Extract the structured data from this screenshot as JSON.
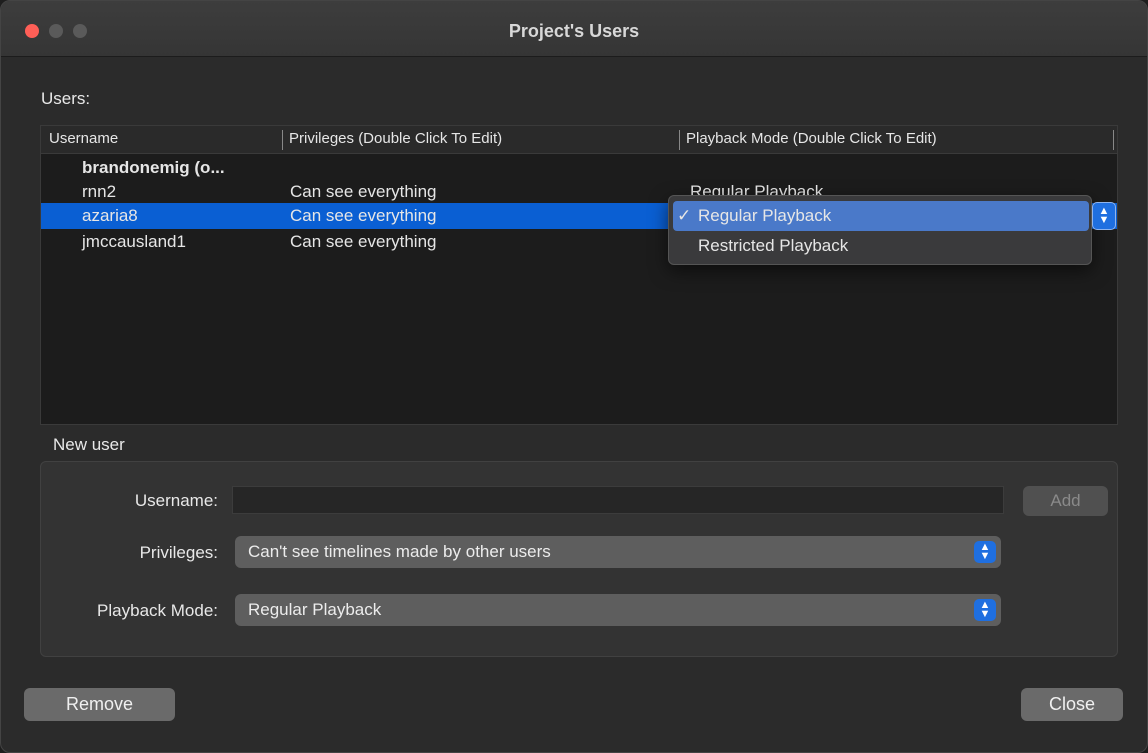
{
  "window": {
    "title": "Project's Users"
  },
  "users_section": {
    "label": "Users:"
  },
  "table": {
    "columns": [
      "Username",
      "Privileges (Double Click To Edit)",
      "Playback Mode (Double Click To Edit)"
    ],
    "rows": [
      {
        "username": "brandonemig (o...",
        "privileges": "",
        "playback": "",
        "owner": true
      },
      {
        "username": "rnn2",
        "privileges": "Can see everything",
        "playback": "Regular Playback"
      },
      {
        "username": "azaria8",
        "privileges": "Can see everything",
        "playback": "Regular Playback",
        "selected": true
      },
      {
        "username": "jmccausland1",
        "privileges": "Can see everything",
        "playback": ""
      }
    ]
  },
  "playback_popup": {
    "options": [
      {
        "label": "Regular Playback",
        "checked": true,
        "check_glyph": "✓"
      },
      {
        "label": "Restricted Playback",
        "checked": false,
        "check_glyph": ""
      }
    ],
    "stepper_icon": "up-down-chevron-icon"
  },
  "new_user": {
    "section_label": "New user",
    "username_label": "Username:",
    "username_value": "",
    "add_label": "Add",
    "privileges_label": "Privileges:",
    "privileges_value": "Can't see timelines made by other users",
    "playback_label": "Playback Mode:",
    "playback_value": "Regular Playback"
  },
  "footer": {
    "remove_label": "Remove",
    "close_label": "Close"
  },
  "colors": {
    "selection": "#0a5fd3",
    "menu_highlight": "#4a79c9",
    "close_traffic_light": "#ff5f57",
    "stepper_accent": "#1f6fe0"
  }
}
